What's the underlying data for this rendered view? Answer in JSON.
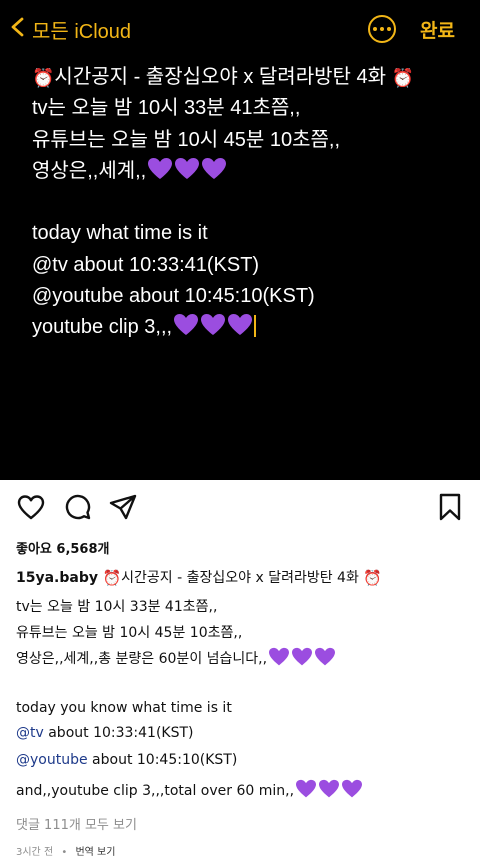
{
  "notes": {
    "back_label": "모든 iCloud",
    "done_label": "완료",
    "title_text": "시간공지 - 출장십오야 x 달려라방탄 4화",
    "line2": "tv는 오늘 밤 10시 33분 41초쯤,,",
    "line3": "유튜브는 오늘 밤 10시 45분 10초쯤,,",
    "line4": "영상은,,세계,,",
    "line6": "today what time is it",
    "line7": "@tv about 10:33:41(KST)",
    "line8": "@youtube about 10:45:10(KST)",
    "line9": "youtube clip 3,,,"
  },
  "post": {
    "likes": "좋아요 6,568개",
    "username": "15ya.baby",
    "caption_line1": "시간공지 - 출장십오야 x 달려라방탄 4화",
    "caption_line2": "tv는 오늘 밤 10시 33분 41초쯤,,",
    "caption_line3": "유튜브는 오늘 밤 10시 45분 10초쯤,,",
    "caption_line4": "영상은,,세계,,총 분량은 60분이 넘습니다,,",
    "caption_line6": "today you know what time is it",
    "mention_tv": "@tv",
    "caption_line7_rest": " about 10:33:41(KST)",
    "mention_youtube": "@youtube",
    "caption_line8_rest": " about 10:45:10(KST)",
    "caption_line9": "and,,youtube clip 3,,,total over 60 min,,",
    "comments_link": "댓글 111개 모두 보기",
    "time_ago": "3시간 전",
    "separator": "•",
    "translate": "번역 보기"
  },
  "colors": {
    "accent_yellow": "#f2b617",
    "heart_purple": "#9b4de0",
    "mention_blue": "#1e3a8a"
  },
  "icons": [
    "chevron-left-icon",
    "ellipsis-circle-icon",
    "alarm-clock-icon",
    "purple-heart-icon",
    "heart-icon",
    "comment-icon",
    "share-icon",
    "bookmark-icon"
  ]
}
